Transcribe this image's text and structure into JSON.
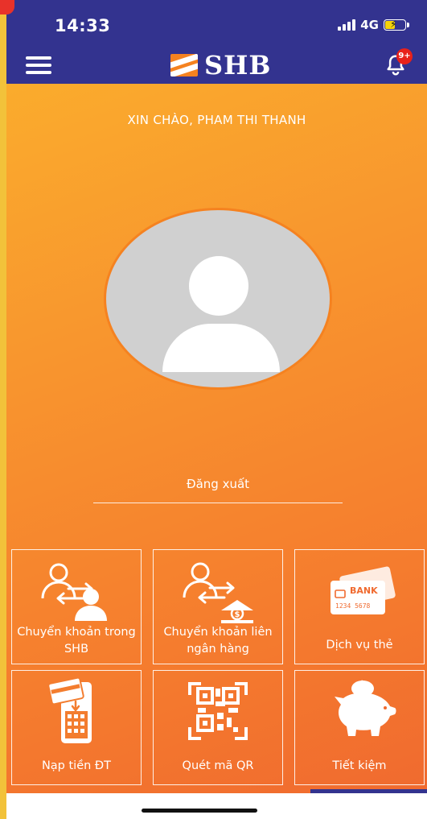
{
  "status_bar": {
    "time": "14:33",
    "network": "4G"
  },
  "header": {
    "brand": "SHB",
    "notification_badge": "9+",
    "colors": {
      "bar": "#33338f",
      "brand_orange": "#f58220",
      "badge": "#e8211a"
    }
  },
  "greeting": "XIN CHÀO, PHAM THI THANH",
  "logout_label": "Đăng xuất",
  "tiles": [
    {
      "label": "Chuyển khoản trong SHB",
      "icon": "transfer-users-icon"
    },
    {
      "label": "Chuyển khoản liên ngân hàng",
      "icon": "interbank-transfer-icon"
    },
    {
      "label": "Dịch vụ thẻ",
      "icon": "bank-card-icon",
      "card_text": "BANK",
      "card_number": "1234 5678"
    },
    {
      "label": "Nạp tiền ĐT",
      "icon": "phone-topup-icon"
    },
    {
      "label": "Quét mã QR",
      "icon": "qr-scan-icon"
    },
    {
      "label": "Tiết kiệm",
      "icon": "piggy-bank-icon"
    }
  ]
}
